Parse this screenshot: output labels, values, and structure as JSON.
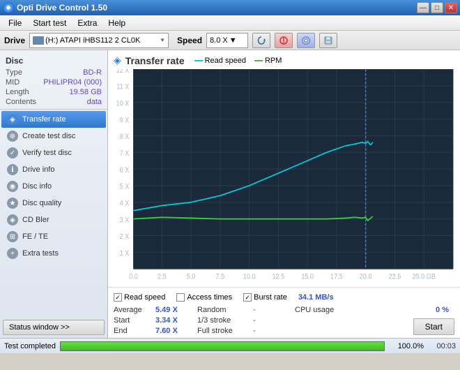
{
  "titleBar": {
    "title": "Opti Drive Control 1.50",
    "controls": [
      "—",
      "□",
      "✕"
    ]
  },
  "menuBar": {
    "items": [
      "File",
      "Start test",
      "Extra",
      "Help"
    ]
  },
  "driveBar": {
    "label": "Drive",
    "driveText": "(H:)  ATAPI iHBS112  2 CL0K",
    "speedLabel": "Speed",
    "speedValue": "8.0 X",
    "icons": [
      "refresh",
      "burn",
      "disc",
      "save"
    ]
  },
  "sidebar": {
    "discSection": {
      "title": "Disc",
      "rows": [
        {
          "key": "Type",
          "val": "BD-R"
        },
        {
          "key": "MID",
          "val": "PHILIPR04 (000)"
        },
        {
          "key": "Length",
          "val": "19.58 GB"
        },
        {
          "key": "Contents",
          "val": "data"
        }
      ]
    },
    "navItems": [
      {
        "label": "Transfer rate",
        "active": true,
        "icon": "chart"
      },
      {
        "label": "Create test disc",
        "active": false,
        "icon": "disc"
      },
      {
        "label": "Verify test disc",
        "active": false,
        "icon": "check"
      },
      {
        "label": "Drive info",
        "active": false,
        "icon": "info"
      },
      {
        "label": "Disc info",
        "active": false,
        "icon": "disc2"
      },
      {
        "label": "Disc quality",
        "active": false,
        "icon": "quality"
      },
      {
        "label": "CD Bler",
        "active": false,
        "icon": "cd"
      },
      {
        "label": "FE / TE",
        "active": false,
        "icon": "te"
      },
      {
        "label": "Extra tests",
        "active": false,
        "icon": "extra"
      }
    ],
    "statusWindowBtn": "Status window >>"
  },
  "chart": {
    "title": "Transfer rate",
    "legend": {
      "readSpeed": "Read speed",
      "rpm": "RPM"
    },
    "xAxis": {
      "labels": [
        "0.0",
        "2.5",
        "5.0",
        "7.5",
        "10.0",
        "12.5",
        "15.0",
        "17.5",
        "20.0",
        "22.5",
        "25.0 GB"
      ]
    },
    "yAxis": {
      "labels": [
        "12 X",
        "11 X",
        "10 X",
        "9 X",
        "8 X",
        "7 X",
        "6 X",
        "5 X",
        "4 X",
        "3 X",
        "2 X",
        "1 X"
      ]
    }
  },
  "checkboxes": {
    "readSpeed": {
      "label": "Read speed",
      "checked": true
    },
    "accessTimes": {
      "label": "Access times",
      "checked": false
    },
    "burstRate": {
      "label": "Burst rate",
      "checked": true,
      "value": "34.1 MB/s"
    }
  },
  "stats": {
    "average": {
      "label": "Average",
      "value": "5.49 X"
    },
    "start": {
      "label": "Start",
      "value": "3.34 X"
    },
    "end": {
      "label": "End",
      "value": "7.60 X"
    },
    "random": {
      "label": "Random",
      "value": "-"
    },
    "oneThirdStroke": {
      "label": "1/3 stroke",
      "value": "-"
    },
    "fullStroke": {
      "label": "Full stroke",
      "value": "-"
    },
    "cpuUsage": {
      "label": "CPU usage",
      "value": "0 %"
    },
    "startBtn": "Start"
  },
  "bottomBar": {
    "statusText": "Test completed",
    "progressPct": "100.0%",
    "time": "00:03"
  }
}
